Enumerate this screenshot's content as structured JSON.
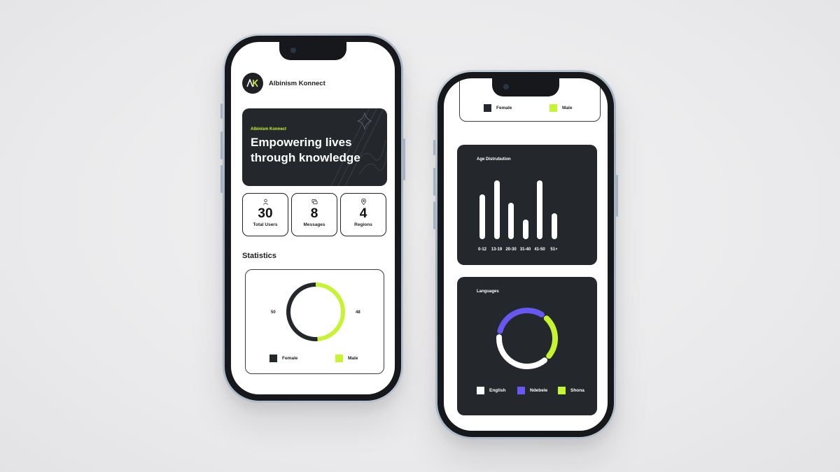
{
  "colors": {
    "dark": "#24272b",
    "accent_green": "#c6f432",
    "accent_purple": "#6658f0",
    "white": "#ffffff"
  },
  "phone1": {
    "app_name": "Albinism Konnect",
    "logo_text": "AK",
    "hero": {
      "eyebrow": "Albinism Konnect",
      "title": "Empowering lives through knowledge"
    },
    "stats": [
      {
        "icon": "user-icon",
        "value": "30",
        "label": "Total Users"
      },
      {
        "icon": "messages-icon",
        "value": "8",
        "label": "Messages"
      },
      {
        "icon": "location-pin-icon",
        "value": "4",
        "label": "Regions"
      }
    ],
    "statistics_title": "Statistics",
    "gender_chart": {
      "female_value": "50",
      "male_value": "48",
      "legend": [
        "Female",
        "Male"
      ]
    }
  },
  "phone2": {
    "gender_legend": [
      "Female",
      "Male"
    ],
    "age_title": "Age Distrubution",
    "languages_title": "Languages",
    "language_legend": [
      "English",
      "Ndebele",
      "Shona"
    ]
  },
  "chart_data": [
    {
      "type": "pie",
      "categories": [
        "Female",
        "Male"
      ],
      "values": [
        50,
        48
      ]
    },
    {
      "type": "bar",
      "title": "Age Distrubution",
      "categories": [
        "0-12",
        "13-19",
        "20-30",
        "31-40",
        "41-50",
        "51+"
      ],
      "values": [
        64,
        84,
        52,
        28,
        84,
        37
      ]
    },
    {
      "type": "pie",
      "title": "Languages",
      "categories": [
        "English",
        "Ndebele",
        "Shona"
      ],
      "values": [
        40,
        33,
        27
      ]
    }
  ]
}
